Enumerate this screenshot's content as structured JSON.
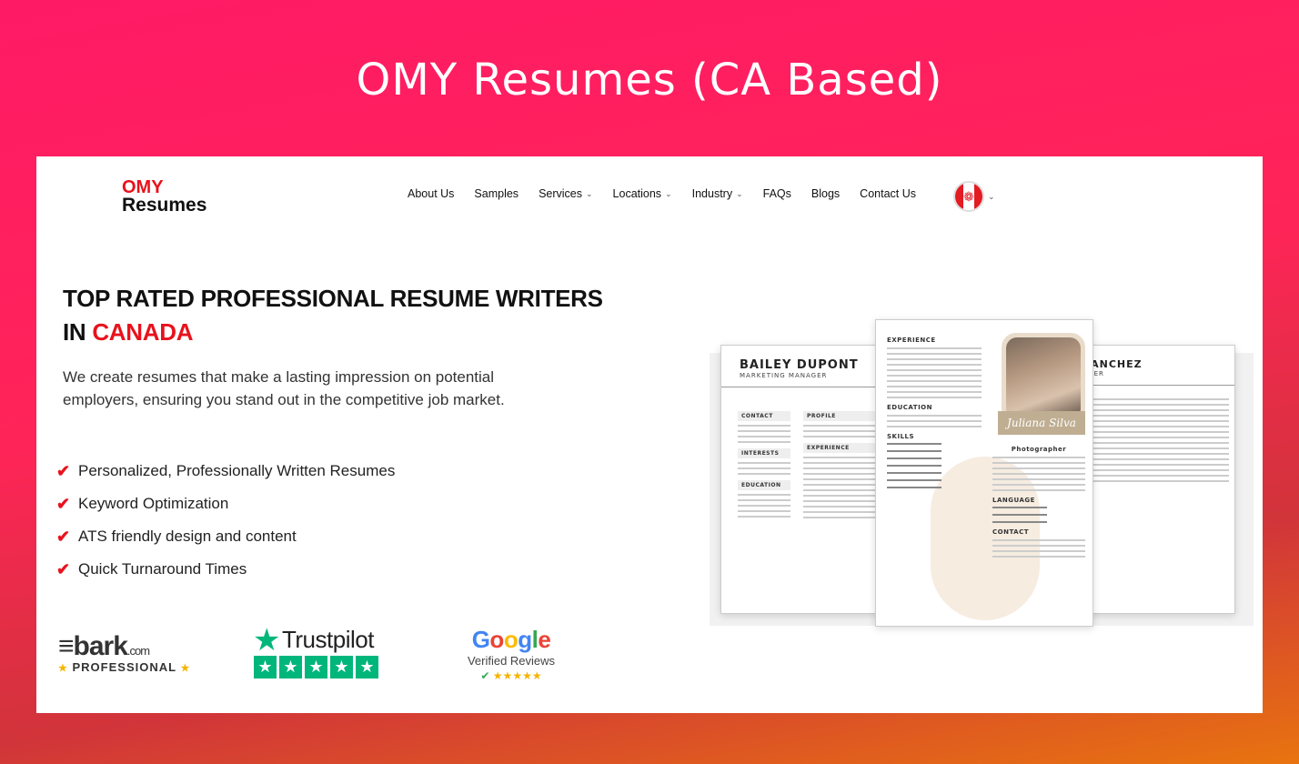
{
  "heading": "OMY Resumes (CA Based)",
  "logo": {
    "top": "OMY",
    "bottom": "Resumes"
  },
  "nav": {
    "items": [
      {
        "label": "About Us",
        "dropdown": false
      },
      {
        "label": "Samples",
        "dropdown": false
      },
      {
        "label": "Services",
        "dropdown": true
      },
      {
        "label": "Locations",
        "dropdown": true
      },
      {
        "label": "Industry",
        "dropdown": true
      },
      {
        "label": "FAQs",
        "dropdown": false
      },
      {
        "label": "Blogs",
        "dropdown": false
      },
      {
        "label": "Contact Us",
        "dropdown": false
      }
    ],
    "country": "canada-flag-icon"
  },
  "hero": {
    "title_line1": "TOP RATED PROFESSIONAL RESUME WRITERS",
    "title_in": "IN ",
    "title_accent": "CANADA",
    "description": "We create resumes that make a lasting impression on potential employers, ensuring you stand out in the competitive job market."
  },
  "features": [
    "Personalized, Professionally Written Resumes",
    "Keyword Optimization",
    "ATS friendly design and content",
    "Quick Turnaround Times"
  ],
  "badges": {
    "bark": {
      "word": "bark",
      "suffix": ".com",
      "tier": "PROFESSIONAL"
    },
    "trustpilot": {
      "name": "Trustpilot",
      "stars": 5
    },
    "google": {
      "g1": "G",
      "g2": "o",
      "g3": "o",
      "g4": "g",
      "g5": "l",
      "g6": "e",
      "subtitle": "Verified Reviews",
      "stars": 5
    }
  },
  "samples": {
    "left": {
      "name": "BAILEY DUPONT",
      "role": "MARKETING MANAGER",
      "sections": [
        "CONTACT",
        "INTERESTS",
        "EDUCATION"
      ],
      "main_sections": [
        "PROFILE",
        "EXPERIENCE"
      ]
    },
    "center": {
      "name": "Juliana Silva",
      "role": "Photographer",
      "left_sections": [
        "EXPERIENCE",
        "EDUCATION",
        "SKILLS"
      ],
      "right_sections": [
        "LANGUAGE",
        "CONTACT"
      ]
    },
    "right": {
      "name": "O SANCHEZ",
      "role": "VELOPER"
    }
  },
  "colors": {
    "accent": "#e8121c",
    "trustpilot": "#00b67a"
  }
}
